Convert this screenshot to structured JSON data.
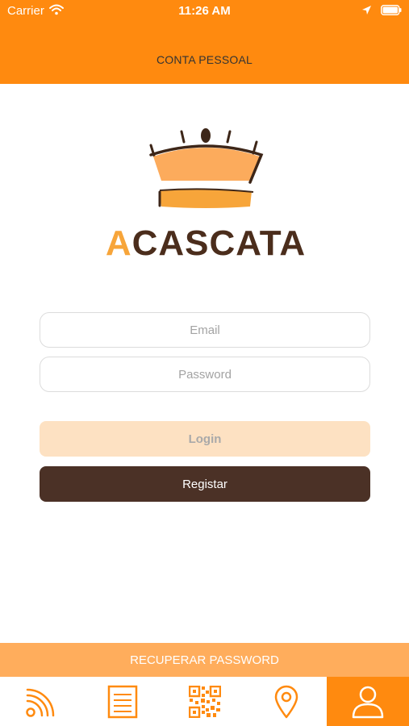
{
  "status_bar": {
    "carrier": "Carrier",
    "time": "11:26 AM"
  },
  "header": {
    "title": "CONTA PESSOAL"
  },
  "brand": {
    "name": "ACASCATA",
    "first_letter": "A",
    "rest": "CASCATA",
    "accent_color": "#f7a53a",
    "dark_color": "#4b2d1c"
  },
  "form": {
    "email_placeholder": "Email",
    "password_placeholder": "Password",
    "login_label": "Login",
    "register_label": "Registar"
  },
  "footer": {
    "recover_label": "RECUPERAR PASSWORD"
  },
  "tabs": [
    {
      "icon": "rss-icon",
      "active": false
    },
    {
      "icon": "document-list-icon",
      "active": false
    },
    {
      "icon": "qr-code-icon",
      "active": false
    },
    {
      "icon": "map-pin-icon",
      "active": false
    },
    {
      "icon": "user-icon",
      "active": true
    }
  ],
  "colors": {
    "primary": "#ff8a0f",
    "secondary": "#ffad5c",
    "login_disabled_bg": "#fde1c2",
    "register_bg": "#4b3126"
  }
}
